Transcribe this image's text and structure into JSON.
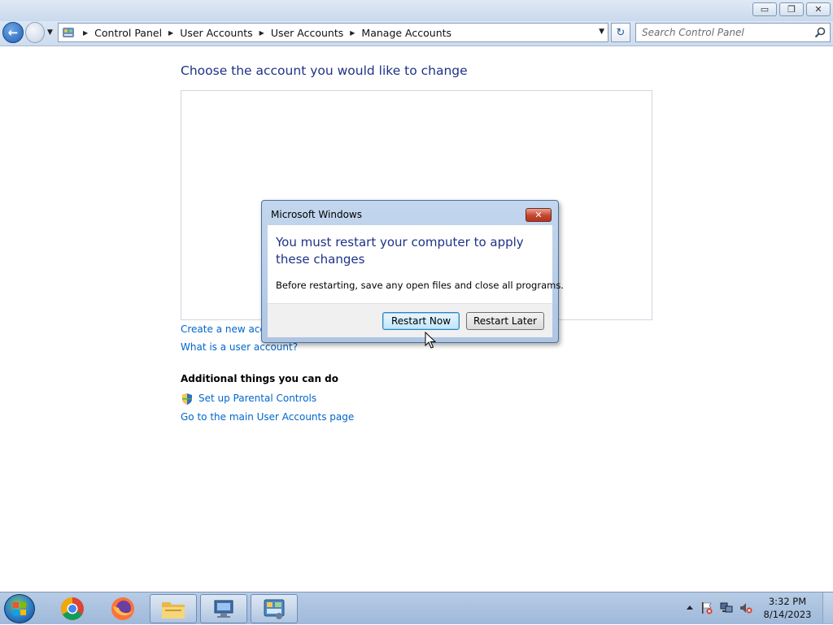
{
  "window": {
    "controls": {
      "minimize": "▭",
      "maximize": "❐",
      "close": "✕"
    }
  },
  "address_bar": {
    "breadcrumb": [
      "Control Panel",
      "User Accounts",
      "User Accounts",
      "Manage Accounts"
    ]
  },
  "search": {
    "placeholder": "Search Control Panel"
  },
  "main": {
    "title": "Choose the account you would like to change",
    "links": {
      "create_account": "Create a new accou",
      "what_is_account": "What is a user account?"
    },
    "additional": {
      "heading": "Additional things you can do",
      "parental_controls": "Set up Parental Controls",
      "main_page": "Go to the main User Accounts page"
    }
  },
  "dialog": {
    "title": "Microsoft Windows",
    "main_instruction": "You must restart your computer to apply these changes",
    "content": "Before restarting, save any open files and close all programs.",
    "buttons": {
      "restart_now": "Restart Now",
      "restart_later": "Restart Later"
    }
  },
  "taskbar": {
    "items": [
      "chrome-icon",
      "firefox-icon",
      "file-explorer-icon",
      "network-icon",
      "control-panel-icon"
    ],
    "clock": {
      "time": "3:32 PM",
      "date": "8/14/2023"
    }
  },
  "colors": {
    "heading_blue": "#1e3287",
    "link_blue": "#0066cc",
    "close_red": "#c7452f"
  }
}
